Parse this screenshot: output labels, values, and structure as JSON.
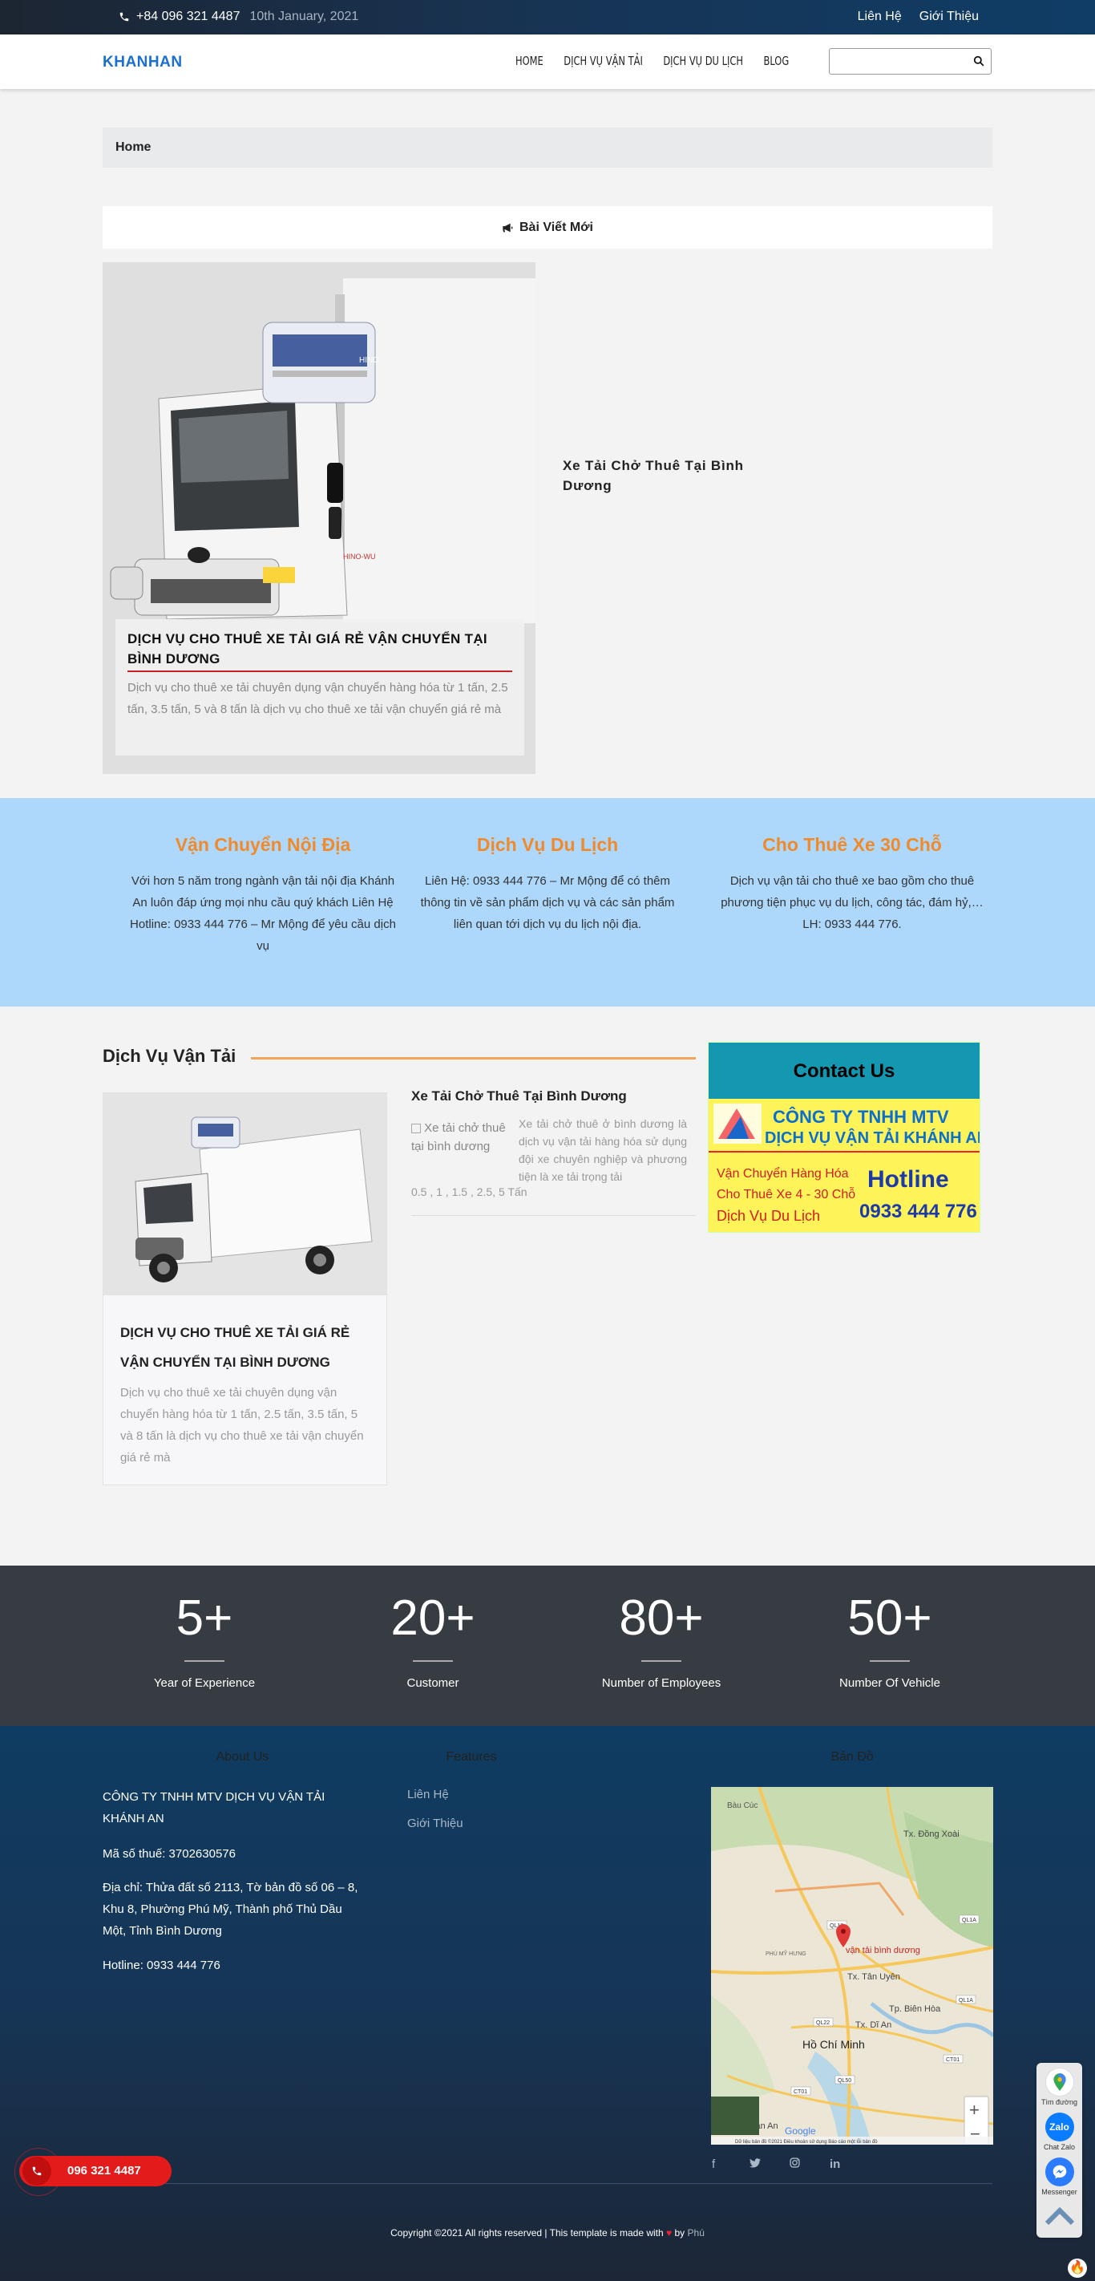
{
  "topbar": {
    "phone": "+84 096 321 4487",
    "date": "10th January, 2021",
    "links": [
      "Liên Hệ",
      "Giới Thiệu"
    ]
  },
  "nav": {
    "logo": "KHANHAN",
    "menu": [
      "HOME",
      "DỊCH VỤ VẬN TẢI",
      "DỊCH VỤ DU LỊCH",
      "BLOG"
    ],
    "search_placeholder": ""
  },
  "breadcrumb": "Home",
  "new_posts": {
    "label": "Bài Viết Mới"
  },
  "featured": {
    "title": "DỊCH VỤ CHO THUÊ XE TẢI GIÁ RẺ VẬN CHUYỂN TẠI BÌNH DƯƠNG",
    "text": "Dịch vụ cho thuê xe tải chuyên dụng vận chuyển hàng hóa từ 1 tấn, 2.5 tấn, 3.5 tấn, 5 và 8 tấn là dịch vụ cho thuê xe tải vận chuyển giá rẻ mà",
    "truck_brand": "HINO-WU",
    "side_post": "Xe Tải Chở Thuê Tại Bình Dương"
  },
  "services": [
    {
      "title": "Vận Chuyển Nội Địa",
      "text": "Với hơn 5 năm trong ngành vận tải nội địa Khánh An luôn đáp ứng mọi nhu cầu quý khách Liên Hệ Hotline: 0933 444 776 – Mr Mộng để yêu cầu dịch vụ"
    },
    {
      "title": "Dịch Vụ Du Lịch",
      "text": "Liên Hệ: 0933 444 776 – Mr Mộng để có thêm thông tin về sản phẩm dịch vụ và các sản phẩm liên quan tới dịch vụ du lịch nội địa."
    },
    {
      "title": "Cho Thuê Xe 30 Chỗ",
      "text": "Dịch vụ vận tải cho thuê xe bao gồm cho thuê phương tiện phục vụ du lịch, công tác, đám hỷ,… LH: 0933 444 776."
    }
  ],
  "transport_section": {
    "title": "Dịch Vụ Vận Tải",
    "card_title": "DỊCH VỤ CHO THUÊ XE TẢI GIÁ RẺ VẬN CHUYỂN TẠI BÌNH DƯƠNG",
    "card_text": "Dịch vụ cho thuê xe tải chuyên dụng vận chuyển hàng hóa từ 1 tấn, 2.5 tấn, 3.5 tấn, 5 và 8 tấn là dịch vụ cho thuê xe tải vận chuyển giá rẻ mà",
    "mini_title": "Xe Tải Chở Thuê Tại Bình Dương",
    "mini_img_alt": "Xe tải chở thuê tại bình dương",
    "mini_text": "Xe tải chở thuê ở bình dương là dịch vụ vận tải hàng hóa sử dụng đội xe chuyên nghiệp và phương tiện là xe tải trọng tải",
    "mini_text2": "0.5 , 1 , 1.5 , 2.5, 5 Tấn"
  },
  "contact": {
    "heading": "Contact Us",
    "company_line1": "CÔNG TY TNHH MTV",
    "company_line2": "DỊCH VỤ VẬN TẢI KHÁNH AN",
    "service1": "Vận Chuyển Hàng Hóa",
    "service2": "Cho Thuê Xe 4 - 30 Chỗ",
    "service3": "Dịch Vụ Du Lịch",
    "hotline_label": "Hotline",
    "hotline": "0933 444 776"
  },
  "stats": [
    {
      "num": "5+",
      "label": "Year of Experience"
    },
    {
      "num": "20+",
      "label": "Customer"
    },
    {
      "num": "80+",
      "label": "Number of Employees"
    },
    {
      "num": "50+",
      "label": "Number Of Vehicle"
    }
  ],
  "footer": {
    "about_heading": "About Us",
    "company": "CÔNG TY TNHH MTV DỊCH VỤ VẬN TẢI KHÁNH AN",
    "tax": "Mã số thuế: 3702630576",
    "address": "Địa chỉ: Thửa đất số 2113, Tờ bản đồ số 06 – 8, Khu 8, Phường Phú Mỹ, Thành phố Thủ Dầu Một, Tỉnh Bình Dương",
    "hotline": "Hotline: 0933 444 776",
    "features_heading": "Features",
    "features": [
      "Liên Hệ",
      "Giới Thiệu"
    ],
    "map_heading": "Bản Đồ",
    "map_labels": {
      "pin": "vận tải bình dương",
      "hcm": "Hồ Chí Minh",
      "bien_hoa": "Tp. Biên Hòa",
      "tan_uyen": "Tx. Tân Uyên",
      "di_an": "Tx. Dĩ An",
      "dong_xoai": "Tx. Đồng Xoài",
      "bau_cuc": "Bàu Cúc",
      "phu_my_hung": "PHÚ MỸ HƯNG",
      "tan_an": "Tp. Tân An",
      "google": "Google",
      "map_footer": "Dữ liệu bản đồ ©2021   Điều khoản sử dụng   Báo cáo một lỗi bản đồ",
      "roads": [
        "QL13",
        "QL1A",
        "QL1A",
        "QL22",
        "QL50",
        "CT01",
        "CT01"
      ]
    },
    "copyright": "Copyright ©2021 All rights reserved | This template is made with",
    "by": "by",
    "author": "Phú"
  },
  "floating": {
    "call": "096 321 4487",
    "maps_label": "Tìm đường",
    "zalo_label": "Chat Zalo",
    "messenger_label": "Messenger",
    "zalo_text": "Zalo"
  },
  "colors": {
    "accent_blue": "#1b6fd1",
    "orange": "#f08a2a",
    "band": "#add8fb",
    "stats_bg": "#373b42",
    "call_red": "#e31b1b"
  }
}
